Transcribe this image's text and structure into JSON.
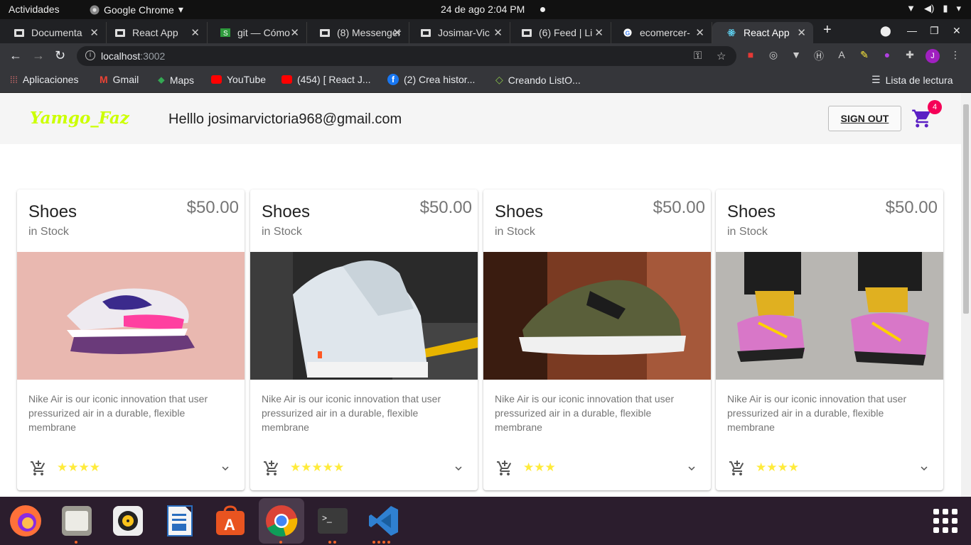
{
  "system": {
    "activities": "Actividades",
    "app_name": "Google Chrome",
    "clock": "24 de ago  2:04 PM"
  },
  "browser": {
    "tabs": [
      {
        "label": "Documenta"
      },
      {
        "label": "React App"
      },
      {
        "label": "git — Cómo"
      },
      {
        "label": "(8) Messenger"
      },
      {
        "label": "Josimar-Vic"
      },
      {
        "label": "(6) Feed | Li"
      },
      {
        "label": "ecomercer-"
      },
      {
        "label": "React App"
      }
    ],
    "url_host": "localhost",
    "url_port": ":3002",
    "bookmarks": [
      {
        "label": "Aplicaciones"
      },
      {
        "label": "Gmail"
      },
      {
        "label": "Maps"
      },
      {
        "label": "YouTube"
      },
      {
        "label": "(454) [ React J..."
      },
      {
        "label": "(2) Crea histor..."
      },
      {
        "label": "Creando ListO..."
      }
    ],
    "reading_list": "Lista de lectura",
    "profile_initial": "J"
  },
  "app": {
    "logo": "Yamgo_Faz",
    "greeting": "Helllo josimarvictoria968@gmail.com",
    "signout_label": "SIGN OUT",
    "cart_count": "4",
    "accent_color": "#5b20c4",
    "badge_color": "#f50057"
  },
  "products": [
    {
      "title": "Shoes",
      "stock": "in Stock",
      "price": "$50.00",
      "description": "Nike Air is our iconic innovation that user pressurized air in a durable, flexible membrane",
      "rating": 4,
      "stars": "★★★★"
    },
    {
      "title": "Shoes",
      "stock": "in Stock",
      "price": "$50.00",
      "description": "Nike Air is our iconic innovation that user pressurized air in a durable, flexible membrane",
      "rating": 5,
      "stars": "★★★★★"
    },
    {
      "title": "Shoes",
      "stock": "in Stock",
      "price": "$50.00",
      "description": "Nike Air is our iconic innovation that user pressurized air in a durable, flexible membrane",
      "rating": 3,
      "stars": "★★★"
    },
    {
      "title": "Shoes",
      "stock": "in Stock",
      "price": "$50.00",
      "description": "Nike Air is our iconic innovation that user pressurized air in a durable, flexible membrane",
      "rating": 4,
      "stars": "★★★★"
    }
  ]
}
